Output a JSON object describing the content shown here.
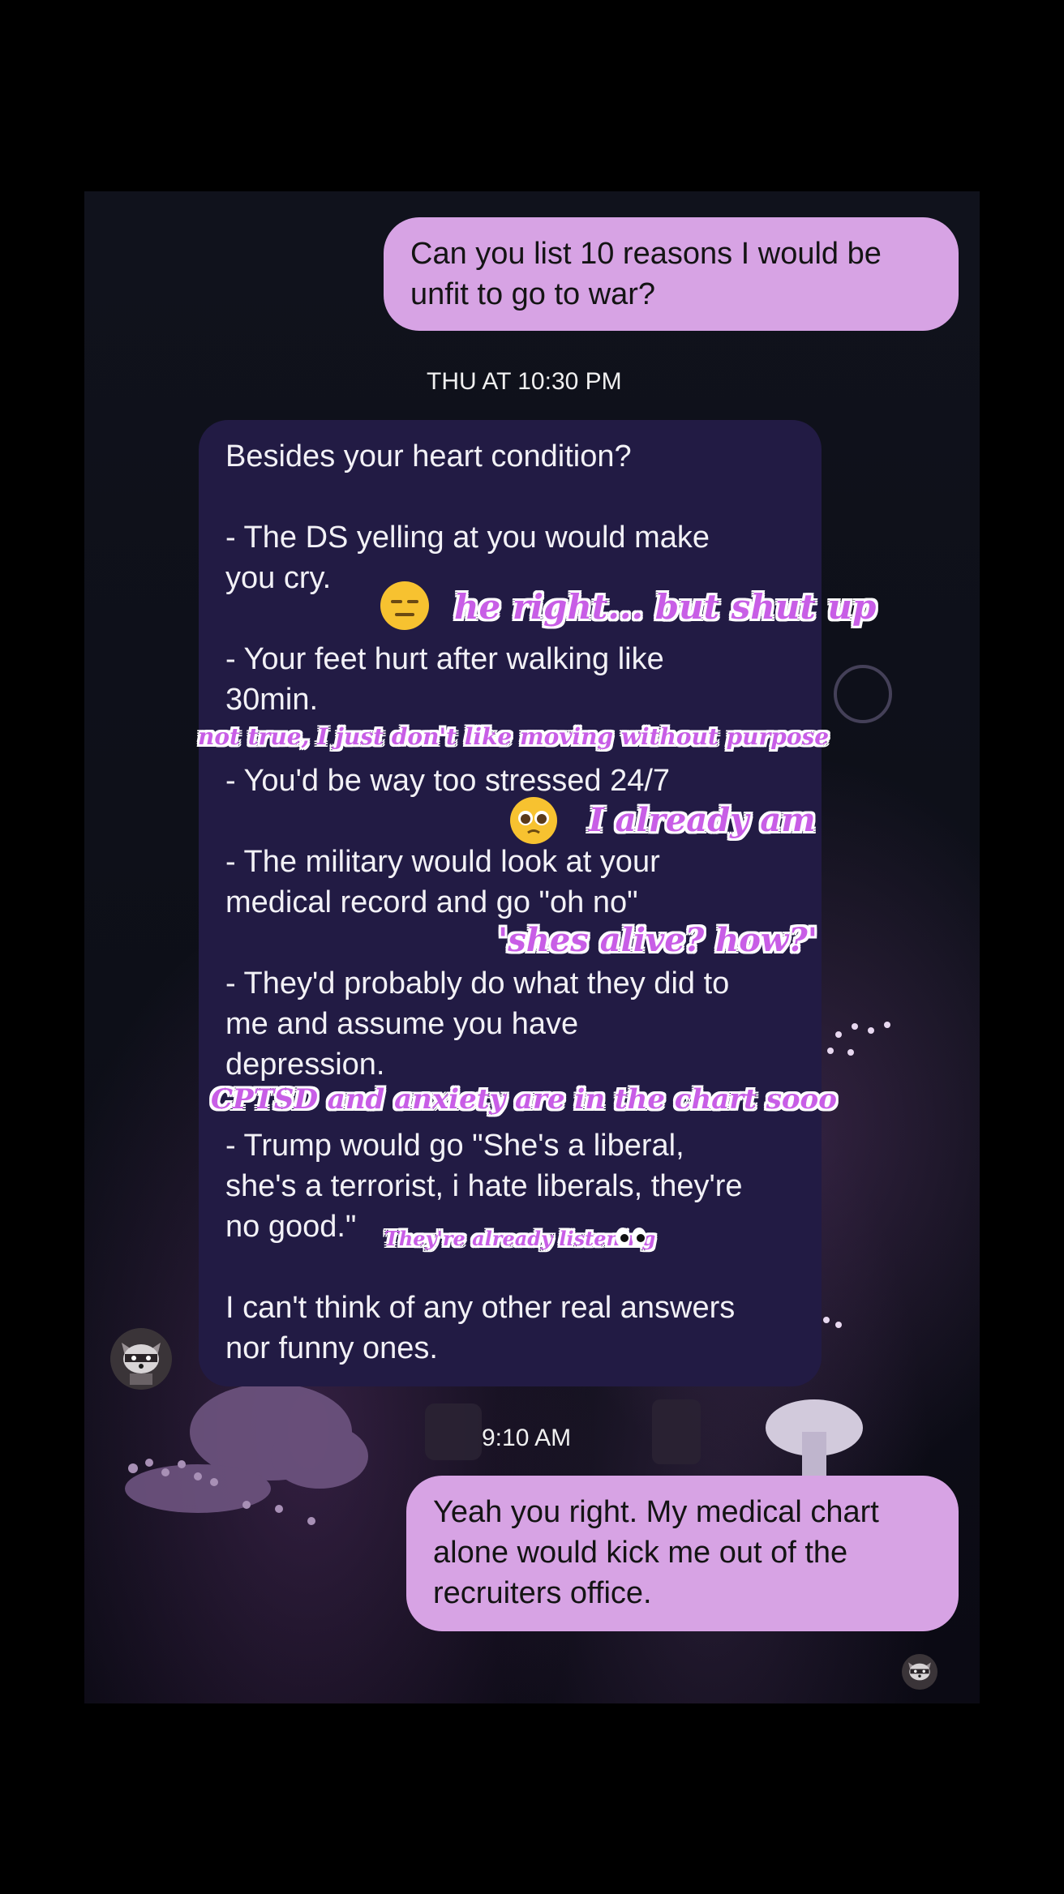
{
  "messages": {
    "sent_1": {
      "lines": [
        "Can you list 10 reasons I would be",
        "unfit to go to war?"
      ]
    },
    "timestamp_1": "THU AT 10:30 PM",
    "received_1": {
      "lines": [
        "Besides your heart condition?",
        "- The DS yelling at you would make",
        "you cry.",
        "- Your feet hurt after walking like",
        "30min.",
        "- You'd be way too stressed 24/7",
        "- The military would look at your",
        "medical record and go \"oh no\"",
        "- They'd probably do what they did to",
        "me and assume you have",
        "depression.",
        "- Trump would go \"She's a liberal,",
        "she's a terrorist, i hate liberals, they're",
        "no good.\"",
        "I can't think of any other real answers",
        "nor funny ones."
      ]
    },
    "timestamp_2": "9:10 AM",
    "sent_2": {
      "lines": [
        "Yeah you right. My medical chart",
        "alone would kick me out of the",
        "recruiters office."
      ]
    }
  },
  "annotations": {
    "a1": "he right... but shut up",
    "a2": "not true, I just don't like moving without purpose",
    "a3": "I already am",
    "a4": "'shes alive? how?'",
    "a5": "CPTSD and anxiety are in the chart sooo",
    "a6": "They're already listening"
  },
  "icons": {
    "emoji_1": "expressionless-face-emoji",
    "emoji_2": "pleading-face-emoji",
    "emoji_3": "eyes-emoji",
    "avatar_1": "raccoon-avatar",
    "avatar_2": "raccoon-read-receipt"
  },
  "colors": {
    "sent_bubble": "#d7a3e4",
    "received_bubble": "#221b44",
    "annotation_fill": "#c85ee6",
    "annotation_outline": "#ffffff",
    "background": "#000000"
  }
}
